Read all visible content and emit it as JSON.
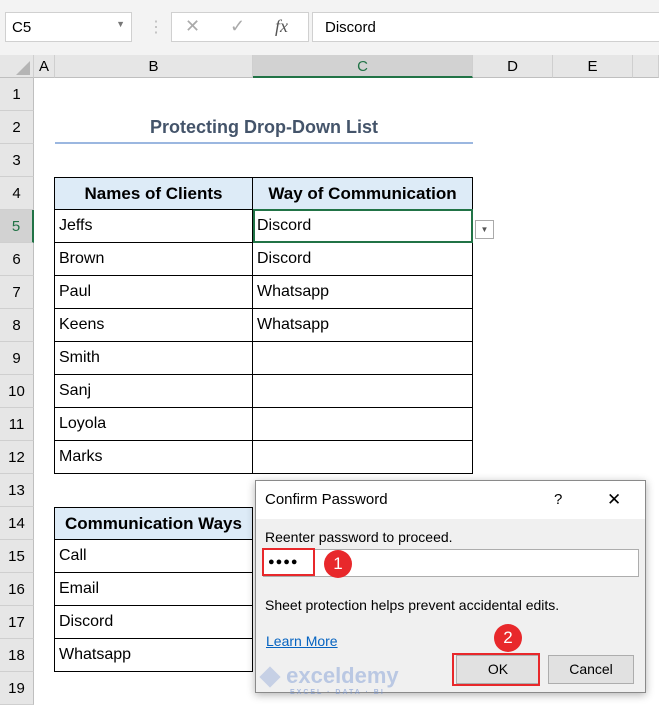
{
  "formula_bar": {
    "name_box": "C5",
    "cancel_icon": "✕",
    "enter_icon": "✓",
    "fx": "fx",
    "value": "Discord"
  },
  "columns": [
    "A",
    "B",
    "C",
    "D",
    "E"
  ],
  "rows": [
    "1",
    "2",
    "3",
    "4",
    "5",
    "6",
    "7",
    "8",
    "9",
    "10",
    "11",
    "12",
    "13",
    "14",
    "15",
    "16",
    "17",
    "18",
    "19"
  ],
  "sheet": {
    "title": "Protecting Drop-Down List",
    "table1": {
      "headers": [
        "Names of Clients",
        "Way of Communication"
      ],
      "rows": [
        [
          "Jeffs",
          "Discord"
        ],
        [
          "Brown",
          "Discord"
        ],
        [
          "Paul",
          "Whatsapp"
        ],
        [
          "Keens",
          "Whatsapp"
        ],
        [
          "Smith",
          ""
        ],
        [
          "Sanj",
          ""
        ],
        [
          "Loyola",
          ""
        ],
        [
          "Marks",
          ""
        ]
      ]
    },
    "table2": {
      "header": "Communication Ways",
      "rows": [
        "Call",
        "Email",
        "Discord",
        "Whatsapp"
      ]
    }
  },
  "dialog": {
    "title": "Confirm Password",
    "help": "?",
    "close": "✕",
    "prompt": "Reenter password to proceed.",
    "password": "●●●●",
    "info": "Sheet protection helps prevent accidental edits.",
    "learn_more": "Learn More",
    "ok": "OK",
    "cancel": "Cancel"
  },
  "annotations": [
    "1",
    "2"
  ],
  "watermark": {
    "brand": "exceldemy",
    "tagline": "EXCEL · DATA · BI"
  },
  "colors": {
    "accent": "#217346",
    "header_fill": "#ddebf7",
    "badge": "#e8282b"
  }
}
